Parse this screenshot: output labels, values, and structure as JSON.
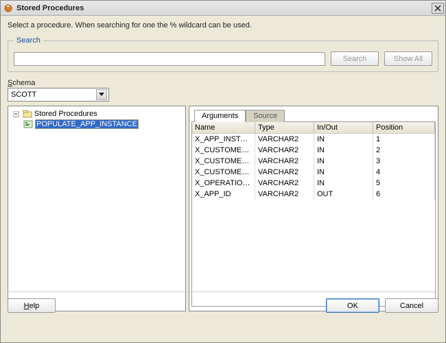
{
  "window": {
    "title": "Stored Procedures"
  },
  "instruction": "Select a procedure. When searching for one the % wildcard can be used.",
  "search": {
    "legend": "Search",
    "value": "",
    "placeholder": "",
    "button_label": "Search",
    "showall_label": "Show All"
  },
  "schema": {
    "label": "Schema",
    "value": "SCOTT"
  },
  "tree": {
    "root_label": "Stored Procedures",
    "items": [
      {
        "label": "POPULATE_APP_INSTANCE",
        "selected": true
      }
    ]
  },
  "tabs": {
    "active": "Arguments",
    "items": [
      "Arguments",
      "Source"
    ]
  },
  "grid": {
    "columns": [
      "Name",
      "Type",
      "In/Out",
      "Position"
    ],
    "rows": [
      {
        "name": "X_APP_INSTAN...",
        "type": "VARCHAR2",
        "io": "IN",
        "pos": "1"
      },
      {
        "name": "X_CUSTOMER_ID",
        "type": "VARCHAR2",
        "io": "IN",
        "pos": "2"
      },
      {
        "name": "X_CUSTOMER_...",
        "type": "VARCHAR2",
        "io": "IN",
        "pos": "3"
      },
      {
        "name": "X_CUSTOMER_...",
        "type": "VARCHAR2",
        "io": "IN",
        "pos": "4"
      },
      {
        "name": "X_OPERATION...",
        "type": "VARCHAR2",
        "io": "IN",
        "pos": "5"
      },
      {
        "name": "X_APP_ID",
        "type": "VARCHAR2",
        "io": "OUT",
        "pos": "6"
      }
    ]
  },
  "buttons": {
    "help": "Help",
    "ok": "OK",
    "cancel": "Cancel"
  }
}
